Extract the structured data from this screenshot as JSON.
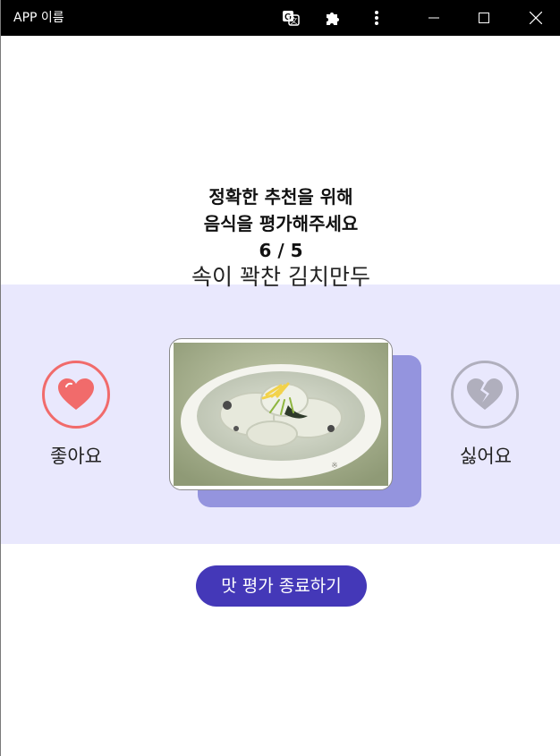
{
  "window": {
    "title": "APP 이름",
    "toolbar_icons": [
      "translate-icon",
      "puzzle-extension-icon",
      "more-vertical-icon"
    ],
    "controls": [
      "minimize-icon",
      "maximize-icon",
      "close-icon"
    ]
  },
  "survey": {
    "line1": "정확한 추천을 위해",
    "line2": "음식을 평가해주세요",
    "progress": "6 / 5",
    "food_name": "속이 꽉찬 김치만두"
  },
  "rating": {
    "like_label": "좋아요",
    "dislike_label": "싫어요",
    "like_color": "#f16b6b",
    "dislike_color": "#b0afbd"
  },
  "actions": {
    "finish_label": "맛 평가 종료하기",
    "finish_color": "#4438b8"
  },
  "colors": {
    "band": "#e9e8fd",
    "card_shadow": "#9494de",
    "titlebar": "#000000"
  }
}
